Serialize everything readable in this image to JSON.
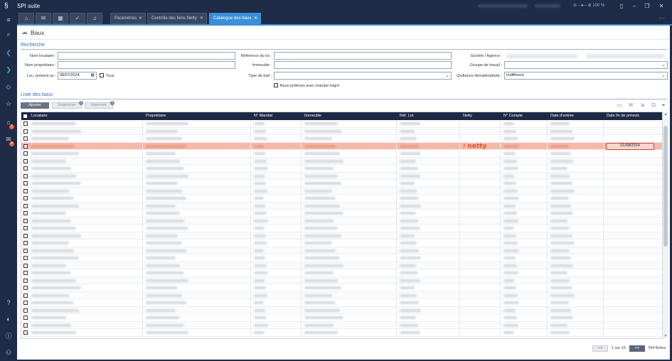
{
  "app": {
    "title": "SPI suite",
    "zoom": "100 %"
  },
  "tabs": [
    {
      "label": "Paramètres"
    },
    {
      "label": "Contrôle des liens Netty"
    },
    {
      "label": "Catalogue des baux"
    }
  ],
  "page": {
    "title": "Baux"
  },
  "search": {
    "section_title": "Recherche",
    "nom_locataire_label": "Nom locataire :",
    "nom_proprietaire_label": "Nom propriétaire :",
    "loc_present_label": "Loc. présent au :",
    "loc_present_value": "08/07/2024",
    "tous_label": "Tous",
    "reference_lot_label": "Référence du lot :",
    "immeuble_label": "Immeuble :",
    "type_bail_label": "Type de bail :",
    "baux_preleves_label": "Baux prélevés avec mandat migré",
    "societe_label": "Société / Agence :",
    "groupe_travail_label": "Groupe de travail :",
    "quittance_label": "Quittance dématérialisée :",
    "quittance_value": "Indifférent"
  },
  "list": {
    "section_title": "Liste des baux",
    "add_label": "Ajouter",
    "delete_label": "Supprimer",
    "print_label": "Imprimer",
    "columns": [
      "Locataire",
      "Propriétaire",
      "N° Mandat",
      "Immeuble",
      "Réf. Lot",
      "Netty",
      "N° Compte",
      "Date d'entrée",
      "Date fin de préavis"
    ],
    "highlight_row": {
      "netty": "netty",
      "date_fin_preavis": "01/08/2024"
    }
  },
  "pager": {
    "prev_label": "<<",
    "page_text": "1 sur 16",
    "next_label": ">>",
    "count_text": "764 fiches"
  }
}
